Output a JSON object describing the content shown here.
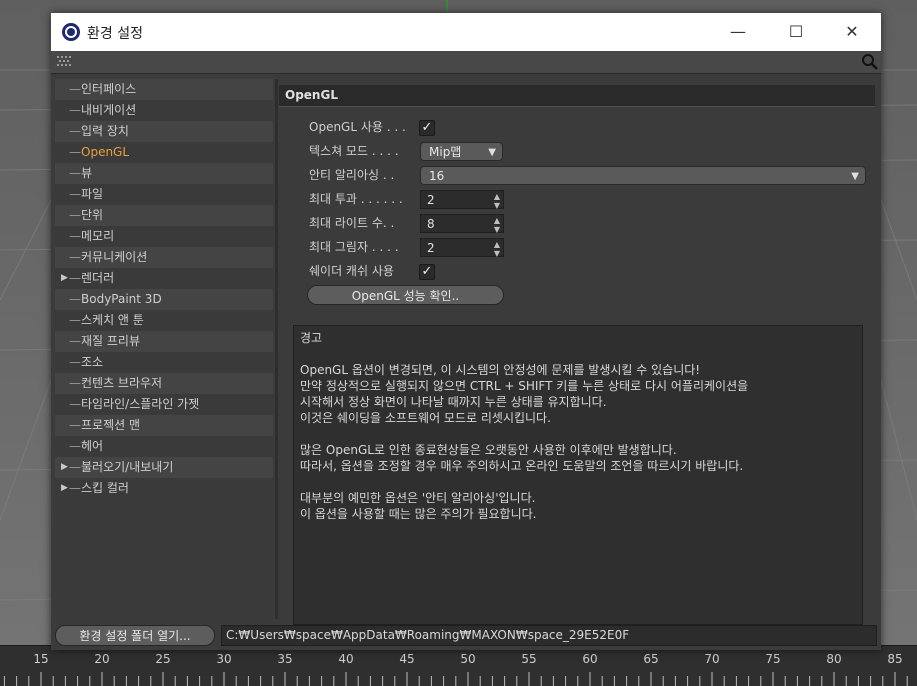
{
  "window": {
    "title": "환경 설정",
    "minimize": "—",
    "maximize": "☐",
    "close": "✕"
  },
  "nav": {
    "items": [
      {
        "label": "인터페이스",
        "expandable": false
      },
      {
        "label": "내비게이션",
        "expandable": false
      },
      {
        "label": "입력 장치",
        "expandable": false
      },
      {
        "label": "OpenGL",
        "expandable": false,
        "active": true
      },
      {
        "label": "뷰",
        "expandable": false
      },
      {
        "label": "파일",
        "expandable": false
      },
      {
        "label": "단위",
        "expandable": false
      },
      {
        "label": "메모리",
        "expandable": false
      },
      {
        "label": "커뮤니케이션",
        "expandable": false
      },
      {
        "label": "렌더러",
        "expandable": true
      },
      {
        "label": "BodyPaint 3D",
        "expandable": false
      },
      {
        "label": "스케치 앤 툰",
        "expandable": false
      },
      {
        "label": "재질 프리뷰",
        "expandable": false
      },
      {
        "label": "조소",
        "expandable": false
      },
      {
        "label": "컨텐츠 브라우저",
        "expandable": false
      },
      {
        "label": "타임라인/스플라인 가젯",
        "expandable": false
      },
      {
        "label": "프로젝션 맨",
        "expandable": false
      },
      {
        "label": "헤어",
        "expandable": false
      },
      {
        "label": "불러오기/내보내기",
        "expandable": true
      },
      {
        "label": "스킵 컬러",
        "expandable": true
      }
    ]
  },
  "panel": {
    "header": "OpenGL",
    "opengl_use": {
      "label": "OpenGL 사용 . . .",
      "checked": true
    },
    "texture_mode": {
      "label": "텍스쳐 모드 . . . .",
      "value": "Mip맵"
    },
    "anti_aliasing": {
      "label": "안티 알리아싱 . .",
      "value": "16"
    },
    "max_transparency": {
      "label": "최대 투과 . . . . . .",
      "value": "2"
    },
    "max_lights": {
      "label": "최대 라이트 수. .",
      "value": "8"
    },
    "max_shadows": {
      "label": "최대 그림자 . . . .",
      "value": "2"
    },
    "shader_cache": {
      "label": "쉐이더 캐쉬 사용",
      "checked": true
    },
    "perf_button": "OpenGL 성능 확인..",
    "warning": {
      "title": "경고",
      "lines1": [
        "OpenGL 옵션이 변경되면, 이 시스템의 안정성에 문제를 발생시킬 수 있습니다!",
        "만약 정상적으로 실행되지 않으면 CTRL + SHIFT 키를 누른 상태로 다시 어플리케이션을",
        "시작해서 정상 화면이 나타날 때까지 누른 상태를 유지합니다.",
        "이것은 쉐이딩을 소프트웨어 모드로 리셋시킵니다."
      ],
      "lines2": [
        "많은 OpenGL로 인한 종료현상들은 오랫동안 사용한 이후에만 발생합니다.",
        "따라서, 옵션을 조정할 경우 매우 주의하시고 온라인 도움말의 조언을 따르시기 바랍니다."
      ],
      "lines3": [
        "대부분의 예민한 옵션은 '안티 알리아싱'입니다.",
        "이 옵션을 사용할 때는 많은 주의가 필요합니다."
      ]
    }
  },
  "footer": {
    "open_folder_button": "환경 설정 폴더 열기...",
    "path": "C:₩Users₩space₩AppData₩Roaming₩MAXON₩space_29E52E0F"
  },
  "ruler": {
    "labels": [
      "15",
      "20",
      "25",
      "30",
      "35",
      "40",
      "45",
      "50",
      "55",
      "60",
      "65",
      "70",
      "75",
      "80",
      "85"
    ]
  }
}
